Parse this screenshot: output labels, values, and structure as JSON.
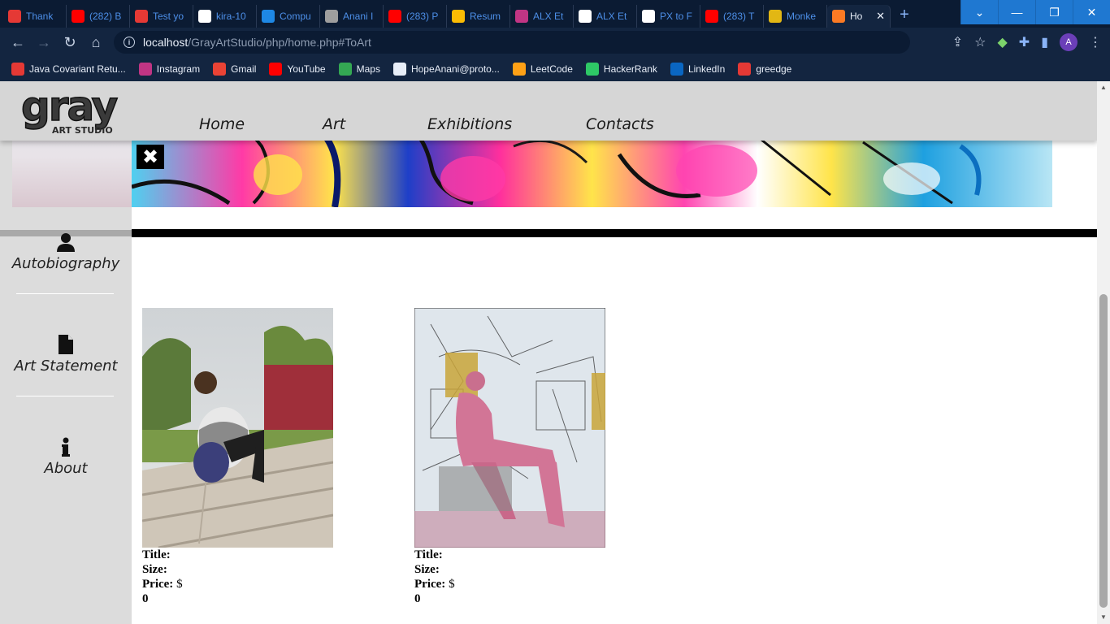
{
  "browser": {
    "tabs": [
      {
        "label": "Thank",
        "icon": "g-icon",
        "color": "#e53935"
      },
      {
        "label": "(282) B",
        "icon": "youtube-icon",
        "color": "#ff0000"
      },
      {
        "label": "Test yo",
        "icon": "g-icon",
        "color": "#e53935"
      },
      {
        "label": "kira-10",
        "icon": "github-icon",
        "color": "#ffffff"
      },
      {
        "label": "Compu",
        "icon": "notion-icon",
        "color": "#1e88e5"
      },
      {
        "label": "Anani I",
        "icon": "globe-icon",
        "color": "#9e9e9e"
      },
      {
        "label": "(283) P",
        "icon": "youtube-icon",
        "color": "#ff0000"
      },
      {
        "label": "Resum",
        "icon": "drive-icon",
        "color": "#fbbc04"
      },
      {
        "label": "ALX Et",
        "icon": "instagram-icon",
        "color": "#c13584"
      },
      {
        "label": "ALX Et",
        "icon": "alx-icon",
        "color": "#ffffff"
      },
      {
        "label": "PX to F",
        "icon": "c-icon",
        "color": "#ffffff"
      },
      {
        "label": "(283) T",
        "icon": "youtube-icon",
        "color": "#ff0000"
      },
      {
        "label": "Monke",
        "icon": "monkey-icon",
        "color": "#e2b714"
      },
      {
        "label": "Ho",
        "icon": "xampp-icon",
        "color": "#fb7a24"
      }
    ],
    "new_tab_symbol": "+",
    "url_host": "localhost",
    "url_path": "/GrayArtStudio/php/home.php#ToArt",
    "profile_initial": "A",
    "bookmarks": [
      {
        "label": "Java Covariant Retu...",
        "icon": "triangle-icon",
        "color": "#e53935"
      },
      {
        "label": "Instagram",
        "icon": "instagram-icon",
        "color": "#c13584"
      },
      {
        "label": "Gmail",
        "icon": "gmail-icon",
        "color": "#ea4335"
      },
      {
        "label": "YouTube",
        "icon": "youtube-icon",
        "color": "#ff0000"
      },
      {
        "label": "Maps",
        "icon": "maps-icon",
        "color": "#34a853"
      },
      {
        "label": "HopeAnani@proto...",
        "icon": "proton-icon",
        "color": "#e8eef8"
      },
      {
        "label": "LeetCode",
        "icon": "leetcode-icon",
        "color": "#ffa116"
      },
      {
        "label": "HackerRank",
        "icon": "hackerrank-icon",
        "color": "#2ec866"
      },
      {
        "label": "LinkedIn",
        "icon": "linkedin-icon",
        "color": "#0a66c2"
      },
      {
        "label": "greedge",
        "icon": "g-icon",
        "color": "#e53935"
      }
    ]
  },
  "site": {
    "logo_text": "gray",
    "logo_sub": "ART STUDIO",
    "nav": {
      "home": "Home",
      "art": "Art",
      "exhibitions": "Exhibitions",
      "contacts": "Contacts"
    },
    "close_symbol": "✖",
    "sidebar": {
      "autobiography": "Autobiography",
      "art_statement": "Art Statement",
      "about": "About"
    },
    "artworks": [
      {
        "title_label": "Title:",
        "title": "",
        "size_label": "Size:",
        "size": "",
        "price_label": "Price:",
        "currency": "$",
        "price": "0"
      },
      {
        "title_label": "Title:",
        "title": "",
        "size_label": "Size:",
        "size": "",
        "price_label": "Price:",
        "currency": "$",
        "price": "0"
      }
    ]
  }
}
